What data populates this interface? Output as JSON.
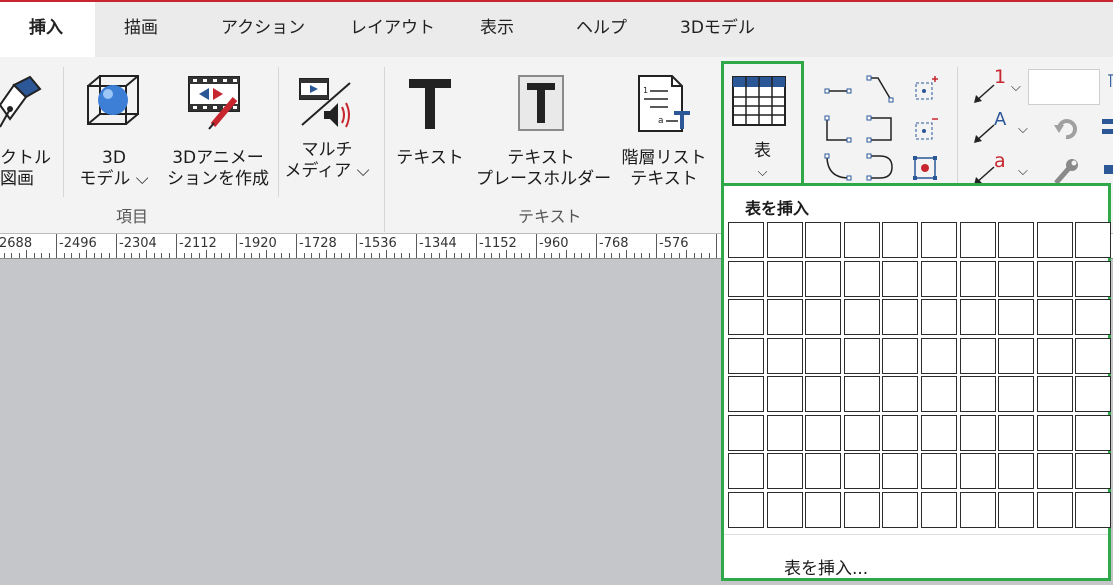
{
  "tabs": [
    {
      "label": "挿入",
      "active": true
    },
    {
      "label": "描画"
    },
    {
      "label": "アクション"
    },
    {
      "label": "レイアウト"
    },
    {
      "label": "表示"
    },
    {
      "label": "ヘルプ"
    },
    {
      "label": "3Dモデル"
    }
  ],
  "ribbon": {
    "vector_line1": "クトル",
    "vector_line2": "図画",
    "model3d_line1": "3D",
    "model3d_line2": "モデル ⌵",
    "anim3d_line1": "3Dアニメー",
    "anim3d_line2": "ションを作成",
    "multimedia_line1": "マルチ",
    "multimedia_line2": "メディア ⌵",
    "text": "テキスト",
    "placeholder_line1": "テキスト",
    "placeholder_line2": "プレースホルダー",
    "hier_line1": "階層リスト",
    "hier_line2": "テキスト",
    "table": "表",
    "table_chevron": "⌵",
    "group_items": "項目",
    "group_text": "テキスト",
    "callout_number": "1",
    "callout_letter_a": "A",
    "callout_letter_a2": "a"
  },
  "ruler": {
    "labels": [
      "2688",
      "-2496",
      "-2304",
      "-2112",
      "-1920",
      "-1728",
      "-1536",
      "-1344",
      "-1152",
      "-960",
      "-768",
      "-576"
    ]
  },
  "dropdown": {
    "title": "表を挿入",
    "rows": 8,
    "cols": 10,
    "menu_item": "表を挿入..."
  },
  "colors": {
    "accent_green": "#2fa84a",
    "title_red": "#c7262f",
    "icon_blue": "#2b5797"
  }
}
